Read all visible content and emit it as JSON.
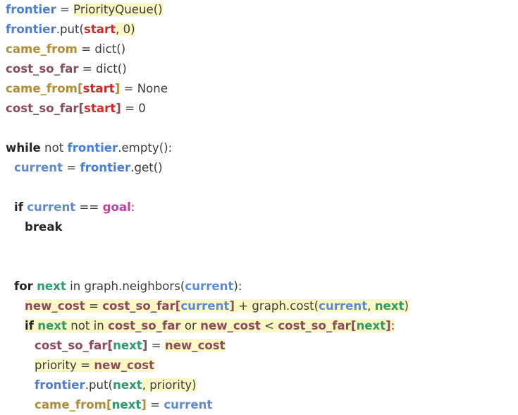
{
  "editor": {
    "language": "python",
    "background_color": "#ffffff",
    "highlight_color": "#fcf8c6",
    "palette": {
      "keyword": "#262626",
      "plain": "#3b3b3b",
      "frontier": "#4a7ed4",
      "current": "#5b8bd8",
      "came_from": "#b08c38",
      "cost_so_far": "#8d4a5d",
      "new_cost": "#8d4a5d",
      "start": "#cc2a26",
      "goal": "#cc38a1",
      "next": "#2c9c6a"
    }
  },
  "code": {
    "lines": [
      {
        "index": 1,
        "indent": 0,
        "text": "frontier = PriorityQueue()",
        "tokens": [
          {
            "t": "frontier",
            "c": "frontier",
            "h": false
          },
          {
            "t": " = ",
            "c": "plain",
            "h": false
          },
          {
            "t": "PriorityQueue()",
            "c": "plain",
            "h": true
          }
        ]
      },
      {
        "index": 2,
        "indent": 0,
        "text": "frontier.put(start, 0)",
        "tokens": [
          {
            "t": "frontier",
            "c": "frontier",
            "h": false
          },
          {
            "t": ".put(",
            "c": "plain",
            "h": false
          },
          {
            "t": "start",
            "c": "start",
            "h": false
          },
          {
            "t": ", 0)",
            "c": "plain",
            "h": true
          }
        ]
      },
      {
        "index": 3,
        "indent": 0,
        "text": "came_from = dict()",
        "tokens": [
          {
            "t": "came_from",
            "c": "came_from",
            "h": false
          },
          {
            "t": " = dict()",
            "c": "plain",
            "h": false
          }
        ]
      },
      {
        "index": 4,
        "indent": 0,
        "text": "cost_so_far = dict()",
        "tokens": [
          {
            "t": "cost_so_far",
            "c": "cost_so_far",
            "h": false
          },
          {
            "t": " = dict()",
            "c": "plain",
            "h": false
          }
        ]
      },
      {
        "index": 5,
        "indent": 0,
        "text": "came_from[start] = None",
        "tokens": [
          {
            "t": "came_from[",
            "c": "came_from",
            "h": false
          },
          {
            "t": "start",
            "c": "start",
            "h": false
          },
          {
            "t": "]",
            "c": "came_from",
            "h": false
          },
          {
            "t": " = None",
            "c": "plain",
            "h": false
          }
        ]
      },
      {
        "index": 6,
        "indent": 0,
        "text": "cost_so_far[start] = 0",
        "tokens": [
          {
            "t": "cost_so_far[",
            "c": "cost_so_far",
            "h": false
          },
          {
            "t": "start",
            "c": "start",
            "h": false
          },
          {
            "t": "]",
            "c": "cost_so_far",
            "h": false
          },
          {
            "t": " = 0",
            "c": "plain",
            "h": false
          }
        ]
      },
      {
        "index": 7,
        "indent": 0,
        "text": "",
        "tokens": []
      },
      {
        "index": 8,
        "indent": 0,
        "text": "while not frontier.empty():",
        "tokens": [
          {
            "t": "while",
            "c": "keyword",
            "h": false
          },
          {
            "t": " not ",
            "c": "plain",
            "h": false
          },
          {
            "t": "frontier",
            "c": "frontier",
            "h": false
          },
          {
            "t": ".empty():",
            "c": "plain",
            "h": false
          }
        ]
      },
      {
        "index": 9,
        "indent": 1,
        "text": "current = frontier.get()",
        "tokens": [
          {
            "t": "current",
            "c": "current",
            "h": false
          },
          {
            "t": " = ",
            "c": "plain",
            "h": false
          },
          {
            "t": "frontier",
            "c": "frontier",
            "h": false
          },
          {
            "t": ".get()",
            "c": "plain",
            "h": false
          }
        ]
      },
      {
        "index": 10,
        "indent": 0,
        "text": "",
        "tokens": []
      },
      {
        "index": 11,
        "indent": 1,
        "text": "if current == goal:",
        "tokens": [
          {
            "t": "if",
            "c": "keyword",
            "h": false
          },
          {
            "t": " ",
            "c": "plain",
            "h": false
          },
          {
            "t": "current",
            "c": "current",
            "h": false
          },
          {
            "t": " == ",
            "c": "plain",
            "h": false
          },
          {
            "t": "goal",
            "c": "goal",
            "h": false
          },
          {
            "t": ":",
            "c": "plain",
            "h": false
          }
        ]
      },
      {
        "index": 12,
        "indent": 2,
        "text": "break",
        "tokens": [
          {
            "t": "break",
            "c": "keyword",
            "h": false
          }
        ]
      },
      {
        "index": 13,
        "indent": 0,
        "text": "",
        "tokens": []
      },
      {
        "index": 14,
        "indent": 0,
        "text": "",
        "tokens": []
      },
      {
        "index": 15,
        "indent": 1,
        "text": "for next in graph.neighbors(current):",
        "tokens": [
          {
            "t": "for",
            "c": "keyword",
            "h": false
          },
          {
            "t": " ",
            "c": "plain",
            "h": false
          },
          {
            "t": "next",
            "c": "next",
            "h": false
          },
          {
            "t": " in graph.neighbors(",
            "c": "plain",
            "h": false
          },
          {
            "t": "current",
            "c": "current",
            "h": false
          },
          {
            "t": "):",
            "c": "plain",
            "h": false
          }
        ]
      },
      {
        "index": 16,
        "indent": 2,
        "text": "new_cost = cost_so_far[current] + graph.cost(current, next)",
        "tokens": [
          {
            "t": "new_cost",
            "c": "new_cost",
            "h": true
          },
          {
            "t": " = ",
            "c": "plain",
            "h": true
          },
          {
            "t": "cost_so_far[",
            "c": "cost_so_far",
            "h": true
          },
          {
            "t": "current",
            "c": "current",
            "h": true
          },
          {
            "t": "]",
            "c": "cost_so_far",
            "h": true
          },
          {
            "t": " + graph.cost(",
            "c": "plain",
            "h": true
          },
          {
            "t": "current",
            "c": "current",
            "h": true
          },
          {
            "t": ", ",
            "c": "plain",
            "h": true
          },
          {
            "t": "next",
            "c": "next",
            "h": true
          },
          {
            "t": ")",
            "c": "plain",
            "h": true
          }
        ]
      },
      {
        "index": 17,
        "indent": 2,
        "text": "if next not in cost_so_far or new_cost < cost_so_far[next]:",
        "tokens": [
          {
            "t": "if",
            "c": "keyword",
            "h": true
          },
          {
            "t": " ",
            "c": "plain",
            "h": true
          },
          {
            "t": "next",
            "c": "next",
            "h": true
          },
          {
            "t": " not in ",
            "c": "plain",
            "h": true
          },
          {
            "t": "cost_so_far",
            "c": "cost_so_far",
            "h": true
          },
          {
            "t": " or ",
            "c": "plain",
            "h": true
          },
          {
            "t": "new_cost",
            "c": "new_cost",
            "h": true
          },
          {
            "t": " < ",
            "c": "plain",
            "h": true
          },
          {
            "t": "cost_so_far[",
            "c": "cost_so_far",
            "h": true
          },
          {
            "t": "next",
            "c": "next",
            "h": true
          },
          {
            "t": "]",
            "c": "cost_so_far",
            "h": true
          },
          {
            "t": ":",
            "c": "plain",
            "h": true
          }
        ]
      },
      {
        "index": 18,
        "indent": 3,
        "text": "cost_so_far[next] = new_cost",
        "tokens": [
          {
            "t": "cost_so_far[",
            "c": "cost_so_far",
            "h": false
          },
          {
            "t": "next",
            "c": "next",
            "h": false
          },
          {
            "t": "]",
            "c": "cost_so_far",
            "h": false
          },
          {
            "t": " = ",
            "c": "plain",
            "h": false
          },
          {
            "t": "new_cost",
            "c": "new_cost",
            "h": true
          }
        ]
      },
      {
        "index": 19,
        "indent": 3,
        "text": "priority = new_cost",
        "tokens": [
          {
            "t": "priority",
            "c": "plain",
            "h": true
          },
          {
            "t": " = ",
            "c": "plain",
            "h": true
          },
          {
            "t": "new_cost",
            "c": "new_cost",
            "h": true
          }
        ]
      },
      {
        "index": 20,
        "indent": 3,
        "text": "frontier.put(next, priority)",
        "tokens": [
          {
            "t": "frontier",
            "c": "frontier",
            "h": false
          },
          {
            "t": ".put(",
            "c": "plain",
            "h": false
          },
          {
            "t": "next",
            "c": "next",
            "h": false
          },
          {
            "t": ", priority)",
            "c": "plain",
            "h": true
          }
        ]
      },
      {
        "index": 21,
        "indent": 3,
        "text": "came_from[next] = current",
        "tokens": [
          {
            "t": "came_from[",
            "c": "came_from",
            "h": false
          },
          {
            "t": "next",
            "c": "next",
            "h": false
          },
          {
            "t": "]",
            "c": "came_from",
            "h": false
          },
          {
            "t": " = ",
            "c": "plain",
            "h": false
          },
          {
            "t": "current",
            "c": "current",
            "h": false
          }
        ]
      }
    ]
  }
}
